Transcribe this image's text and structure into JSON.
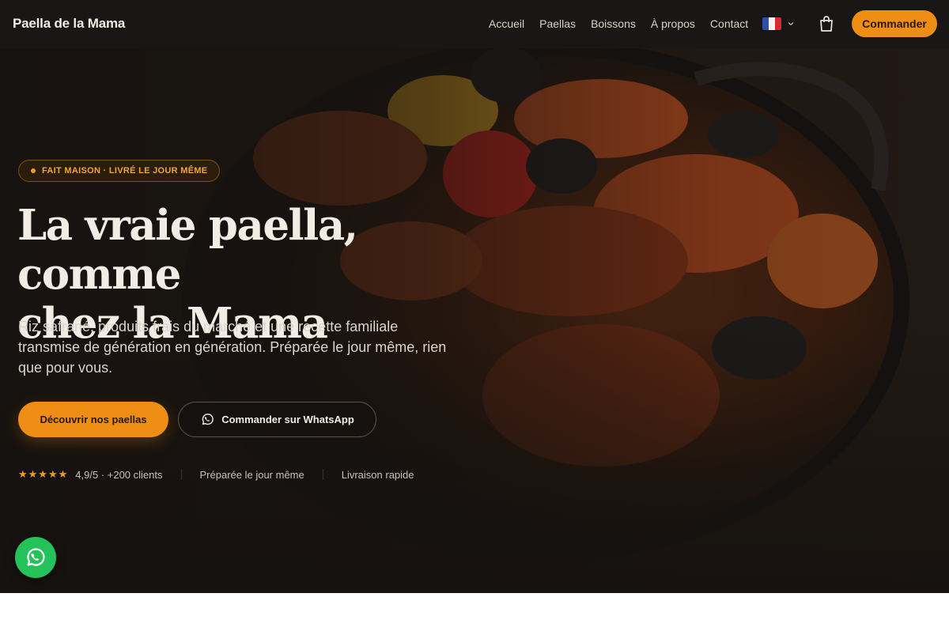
{
  "nav": {
    "brand": "Paella de la Mama",
    "links": [
      "Accueil",
      "Paellas",
      "Boissons",
      "À propos",
      "Contact"
    ],
    "language_flag": "fr-flag-icon",
    "cta": "Commander"
  },
  "hero": {
    "badge": "Fait maison · Livré le jour même",
    "headline_line1": "La vraie paella, comme",
    "headline_line2": "chez la Mama",
    "subtitle": "Riz safrané, produits frais du marché et une recette familiale transmise de génération en génération. Préparée le jour même, rien que pour vous.",
    "primary_button": "Découvrir nos paellas",
    "secondary_button": "Commander sur WhatsApp",
    "rating_stars": "★★★★★",
    "rating_text": "4,9/5 · +200 clients",
    "stat_2": "Préparée le jour même",
    "stat_3": "Livraison rapide"
  },
  "colors": {
    "accent": "#ee8e14",
    "nav_bg": "#191715",
    "whatsapp": "#25c15a"
  }
}
